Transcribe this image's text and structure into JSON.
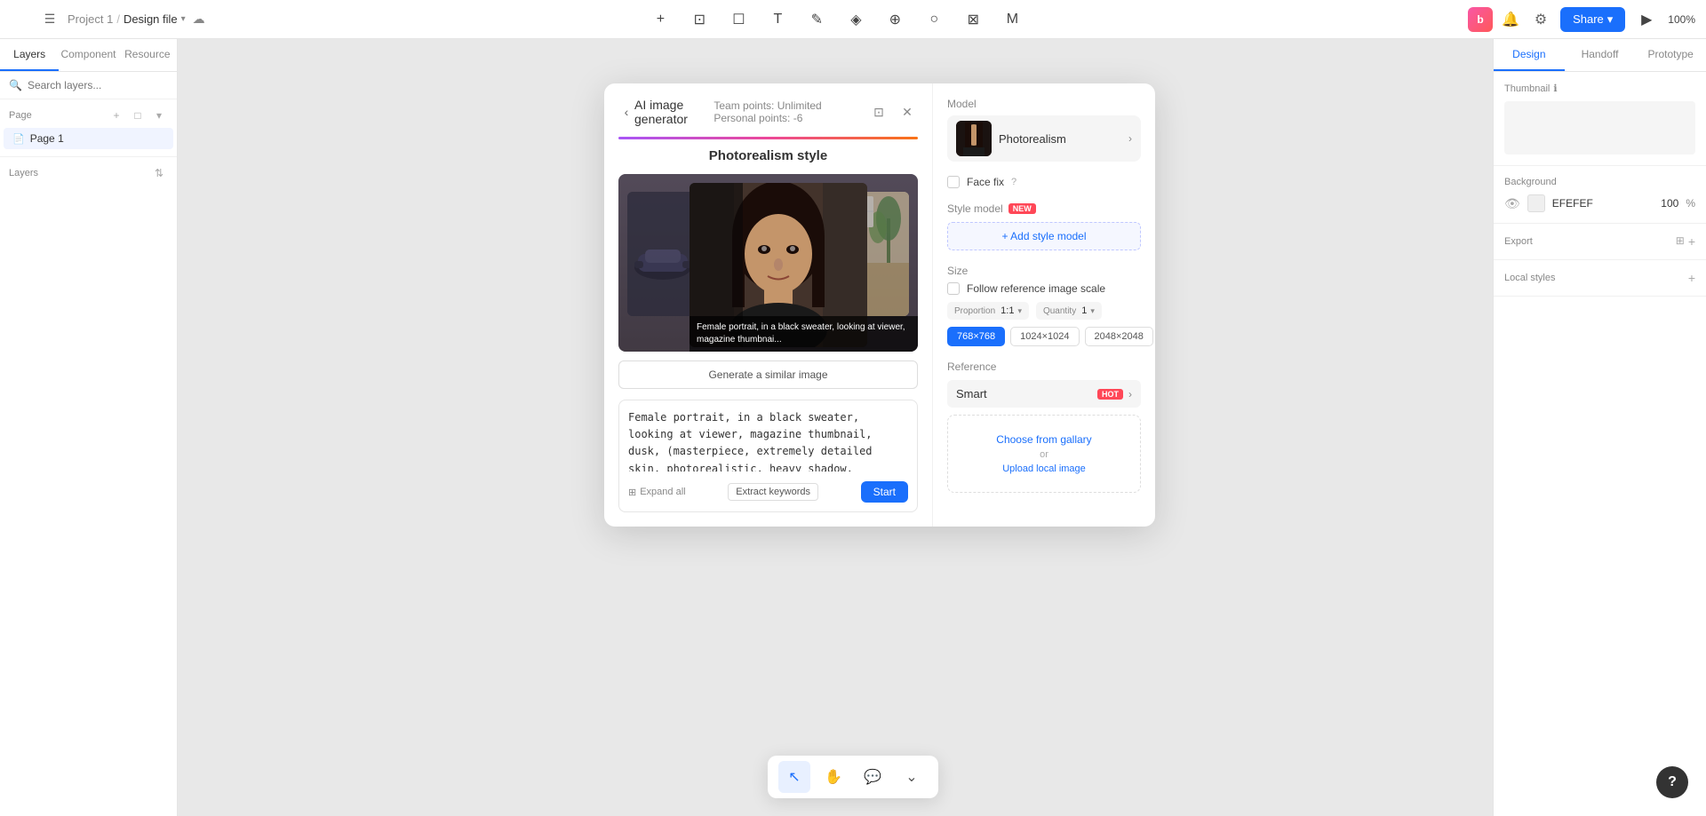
{
  "topbar": {
    "back_label": "‹",
    "menu_label": "☰",
    "project": "Project 1",
    "separator": "/",
    "filename": "Design file",
    "chevron": "▾",
    "cloud": "☁",
    "add_btn": "+",
    "frame_btn": "⊡",
    "shape_btn": "☐",
    "text_btn": "T",
    "pen_btn": "✎",
    "component_btn": "◈",
    "boolean_btn": "⊕",
    "ellipse_btn": "○",
    "crop_btn": "⊠",
    "plugin_btn": "M",
    "share_label": "Share",
    "share_chevron": "▾",
    "play_btn": "▶",
    "zoom": "100%"
  },
  "left_panel": {
    "tab_layers": "Layers",
    "tab_component": "Component",
    "tab_resource": "Resource",
    "search_placeholder": "Search layers...",
    "page_section": "Page",
    "add_page_btn": "+",
    "folder_btn": "□",
    "expand_btn": "▾",
    "page1_label": "Page 1",
    "layers_title": "Layers",
    "layers_sort": "⇅"
  },
  "right_panel": {
    "tab_design": "Design",
    "tab_handoff": "Handoff",
    "tab_prototype": "Prototype",
    "thumbnail_label": "Thumbnail",
    "info_icon": "ℹ",
    "background_label": "Background",
    "eye_icon": "👁",
    "bg_color": "EFEFEF",
    "bg_opacity": "100",
    "percent": "%",
    "export_label": "Export",
    "export_icon": "⊞",
    "export_add": "+",
    "local_styles_label": "Local styles",
    "local_styles_add": "+"
  },
  "ai_modal": {
    "back_btn": "‹",
    "title": "AI image generator",
    "team_points": "Team points: Unlimited",
    "personal_points": "Personal points: -6",
    "pin_icon": "⊡",
    "close_icon": "✕",
    "style_title": "Photorealism style",
    "generate_btn": "Generate a similar image",
    "caption": "Female portrait, in a black sweater, looking at viewer, magazine thumbnai...",
    "prompt_text": "Female portrait, in a black sweater, looking at viewer, magazine thumbnail, dusk, (masterpiece, extremely detailed skin, photorealistic, heavy shadow, dramatic and cinematic lighting,",
    "expand_all": "Expand all",
    "expand_icon": "⊞",
    "extract_keywords": "Extract keywords",
    "start_btn": "Start",
    "model_label": "Model",
    "model_name": "Photorealism",
    "model_chevron": "›",
    "face_fix_label": "Face fix",
    "help_icon": "?",
    "style_model_label": "Style model",
    "new_badge": "NEW",
    "add_style_btn": "+ Add style model",
    "size_label": "Size",
    "follow_ref_label": "Follow reference image scale",
    "proportion_label": "Proportion",
    "proportion_value": "1:1",
    "quantity_label": "Quantity",
    "quantity_value": "1",
    "res_768": "768×768",
    "res_1024": "1024×1024",
    "res_2048": "2048×2048",
    "reference_label": "Reference",
    "smart_label": "Smart",
    "hot_badge": "HOT",
    "smart_chevron": "›",
    "choose_gallery": "Choose from gallary",
    "upload_or": "or",
    "upload_local": "Upload local image"
  },
  "bottom_toolbar": {
    "cursor_icon": "↖",
    "hand_icon": "✋",
    "comment_icon": "💬",
    "more_icon": "⌄"
  },
  "help_btn": "?"
}
